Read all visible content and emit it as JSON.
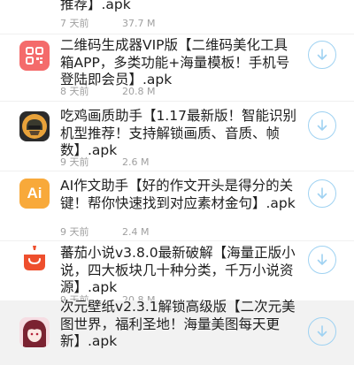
{
  "items": [
    {
      "title": "推荐】.apk",
      "time": "7 天前",
      "size": "37.7 M"
    },
    {
      "title": "二维码生成器VIP版【二维码美化工具箱APP，多类功能+海量模板！手机号登陆即会员】.apk",
      "time": "8 天前",
      "size": "20.8 M"
    },
    {
      "title": "吃鸡画质助手【1.17最新版！智能识别机型推荐！支持解锁画质、音质、帧数】.apk",
      "time": "9 天前",
      "size": "2.6 M"
    },
    {
      "title": "AI作文助手【好的作文开头是得分的关键！帮你快速找到对应素材金句】.apk",
      "time": "9 天前",
      "size": "2.4 M"
    },
    {
      "title": "蕃茄小说v3.8.0最新破解【海量正版小说，四大板块几十种分类，千万小说资源】.apk",
      "time": "9 天前",
      "size": "20.8 M"
    },
    {
      "title": "次元壁纸v2.3.1解锁高级版【二次元美图世界，福利圣地！海量美图每天更新】.apk",
      "time": "",
      "size": ""
    }
  ],
  "icons": {
    "qr": "qr-code-icon",
    "pubg": "game-helmet-icon",
    "ai": "ai-text",
    "ai_text": "Ai",
    "tomato": "tomato-book-icon",
    "anime": "anime-avatar-icon",
    "download": "download-icon"
  },
  "colors": {
    "download_ring": "#9fd2f2",
    "qr_bg": "#f46b6b",
    "ai_bg": "#f8a93a",
    "tomato": "#ee4f2d",
    "meta_text": "#a0a0a0"
  }
}
